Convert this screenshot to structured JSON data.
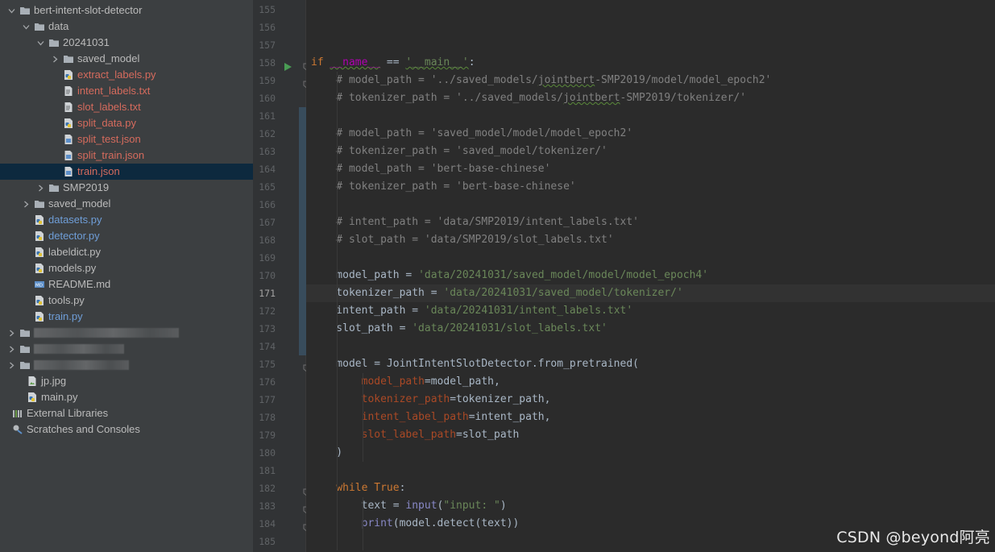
{
  "project_tree": {
    "items": [
      {
        "label": "bert-intent-slot-detector",
        "depth": 0,
        "type": "folder",
        "expanded": true,
        "color": "plain"
      },
      {
        "label": "data",
        "depth": 1,
        "type": "folder",
        "expanded": true,
        "color": "plain"
      },
      {
        "label": "20241031",
        "depth": 2,
        "type": "folder",
        "expanded": true,
        "color": "plain"
      },
      {
        "label": "saved_model",
        "depth": 3,
        "type": "folder",
        "expanded": false,
        "color": "plain"
      },
      {
        "label": "extract_labels.py",
        "depth": 3,
        "type": "python",
        "color": "red"
      },
      {
        "label": "intent_labels.txt",
        "depth": 3,
        "type": "text",
        "color": "red"
      },
      {
        "label": "slot_labels.txt",
        "depth": 3,
        "type": "text",
        "color": "red"
      },
      {
        "label": "split_data.py",
        "depth": 3,
        "type": "python",
        "color": "red"
      },
      {
        "label": "split_test.json",
        "depth": 3,
        "type": "json",
        "color": "red"
      },
      {
        "label": "split_train.json",
        "depth": 3,
        "type": "json",
        "color": "red"
      },
      {
        "label": "train.json",
        "depth": 3,
        "type": "json",
        "color": "red",
        "selected": true
      },
      {
        "label": "SMP2019",
        "depth": 2,
        "type": "folder",
        "expanded": false,
        "color": "plain"
      },
      {
        "label": "saved_model",
        "depth": 1,
        "type": "folder",
        "expanded": false,
        "color": "plain"
      },
      {
        "label": "datasets.py",
        "depth": 1,
        "type": "python",
        "color": "blue"
      },
      {
        "label": "detector.py",
        "depth": 1,
        "type": "python",
        "color": "blue"
      },
      {
        "label": "labeldict.py",
        "depth": 1,
        "type": "python",
        "color": "plain"
      },
      {
        "label": "models.py",
        "depth": 1,
        "type": "python",
        "color": "plain"
      },
      {
        "label": "README.md",
        "depth": 1,
        "type": "markdown",
        "color": "plain"
      },
      {
        "label": "tools.py",
        "depth": 1,
        "type": "python",
        "color": "plain"
      },
      {
        "label": "train.py",
        "depth": 1,
        "type": "python",
        "color": "blue"
      },
      {
        "label": "",
        "depth": 0,
        "type": "blurred",
        "blur_width": 180
      },
      {
        "label": "",
        "depth": 0,
        "type": "blurred",
        "blur_width": 112
      },
      {
        "label": "",
        "depth": 0,
        "type": "blurred",
        "blur_width": 118
      },
      {
        "label": "jp.jpg",
        "depth": 0.5,
        "type": "image",
        "color": "plain"
      },
      {
        "label": "main.py",
        "depth": 0.5,
        "type": "python",
        "color": "plain"
      },
      {
        "label": "External Libraries",
        "depth": -0.5,
        "type": "libraries",
        "color": "plain"
      },
      {
        "label": "Scratches and Consoles",
        "depth": -0.5,
        "type": "scratches",
        "color": "plain"
      }
    ]
  },
  "editor": {
    "current_line": 171,
    "lines": [
      {
        "n": 155,
        "tokens": []
      },
      {
        "n": 156,
        "tokens": []
      },
      {
        "n": 157,
        "tokens": []
      },
      {
        "n": 158,
        "run": true,
        "fold": true,
        "tokens": [
          {
            "t": "if ",
            "c": "k"
          },
          {
            "t": "__name__",
            "c": "d squig"
          },
          {
            "t": " == ",
            "c": ""
          },
          {
            "t": "'__main__'",
            "c": "s squig"
          },
          {
            "t": ":",
            "c": ""
          }
        ]
      },
      {
        "n": 159,
        "fold": true,
        "tokens": [
          {
            "t": "    # model_path = '../saved_models/",
            "c": "c"
          },
          {
            "t": "jointbert",
            "c": "c squig"
          },
          {
            "t": "-SMP2019/model/model_epoch2'",
            "c": "c"
          }
        ]
      },
      {
        "n": 160,
        "tokens": [
          {
            "t": "    # tokenizer_path = '../saved_models/",
            "c": "c"
          },
          {
            "t": "jointbert",
            "c": "c squig"
          },
          {
            "t": "-SMP2019/tokenizer/'",
            "c": "c"
          }
        ]
      },
      {
        "n": 161,
        "tokens": []
      },
      {
        "n": 162,
        "tokens": [
          {
            "t": "    # model_path = 'saved_model/model/model_epoch2'",
            "c": "c"
          }
        ]
      },
      {
        "n": 163,
        "tokens": [
          {
            "t": "    # tokenizer_path = 'saved_model/tokenizer/'",
            "c": "c"
          }
        ]
      },
      {
        "n": 164,
        "tokens": [
          {
            "t": "    # model_path = 'bert-base-chinese'",
            "c": "c"
          }
        ]
      },
      {
        "n": 165,
        "tokens": [
          {
            "t": "    # tokenizer_path = 'bert-base-chinese'",
            "c": "c"
          }
        ]
      },
      {
        "n": 166,
        "tokens": []
      },
      {
        "n": 167,
        "tokens": [
          {
            "t": "    # intent_path = 'data/SMP2019/intent_labels.txt'",
            "c": "c"
          }
        ]
      },
      {
        "n": 168,
        "fold": true,
        "tokens": [
          {
            "t": "    # slot_path = 'data/SMP2019/slot_labels.txt'",
            "c": "c"
          }
        ]
      },
      {
        "n": 169,
        "tokens": []
      },
      {
        "n": 170,
        "tokens": [
          {
            "t": "    model_path = ",
            "c": ""
          },
          {
            "t": "'data/20241031/saved_model/model/model_epoch4'",
            "c": "s"
          }
        ]
      },
      {
        "n": 171,
        "tokens": [
          {
            "t": "    tokenizer_path = ",
            "c": ""
          },
          {
            "t": "'data/20241031/saved_model/tokenizer/'",
            "c": "s"
          }
        ]
      },
      {
        "n": 172,
        "tokens": [
          {
            "t": "    intent_path = ",
            "c": ""
          },
          {
            "t": "'data/20241031/intent_labels.txt'",
            "c": "s"
          }
        ]
      },
      {
        "n": 173,
        "tokens": [
          {
            "t": "    slot_path = ",
            "c": ""
          },
          {
            "t": "'data/20241031/slot_labels.txt'",
            "c": "s"
          }
        ]
      },
      {
        "n": 174,
        "tokens": []
      },
      {
        "n": 175,
        "fold": true,
        "tokens": [
          {
            "t": "    model = JointIntentSlotDetector.from_pretrained(",
            "c": ""
          }
        ]
      },
      {
        "n": 176,
        "tokens": [
          {
            "t": "        ",
            "c": ""
          },
          {
            "t": "model_path",
            "c": "p"
          },
          {
            "t": "=model_path,",
            "c": ""
          }
        ]
      },
      {
        "n": 177,
        "tokens": [
          {
            "t": "        ",
            "c": ""
          },
          {
            "t": "tokenizer_path",
            "c": "p"
          },
          {
            "t": "=tokenizer_path,",
            "c": ""
          }
        ]
      },
      {
        "n": 178,
        "tokens": [
          {
            "t": "        ",
            "c": ""
          },
          {
            "t": "intent_label_path",
            "c": "p"
          },
          {
            "t": "=intent_path,",
            "c": ""
          }
        ]
      },
      {
        "n": 179,
        "tokens": [
          {
            "t": "        ",
            "c": ""
          },
          {
            "t": "slot_label_path",
            "c": "p"
          },
          {
            "t": "=slot_path",
            "c": ""
          }
        ]
      },
      {
        "n": 180,
        "tokens": [
          {
            "t": "    )",
            "c": ""
          }
        ]
      },
      {
        "n": 181,
        "tokens": []
      },
      {
        "n": 182,
        "fold": true,
        "tokens": [
          {
            "t": "    ",
            "c": ""
          },
          {
            "t": "while ",
            "c": "k"
          },
          {
            "t": "True",
            "c": "k"
          },
          {
            "t": ":",
            "c": ""
          }
        ]
      },
      {
        "n": 183,
        "fold": true,
        "tokens": [
          {
            "t": "        text = ",
            "c": ""
          },
          {
            "t": "input",
            "c": "b"
          },
          {
            "t": "(",
            "c": ""
          },
          {
            "t": "\"input: \"",
            "c": "s"
          },
          {
            "t": ")",
            "c": ""
          }
        ]
      },
      {
        "n": 184,
        "fold": true,
        "tokens": [
          {
            "t": "        ",
            "c": ""
          },
          {
            "t": "print",
            "c": "b"
          },
          {
            "t": "(model.detect(text))",
            "c": ""
          }
        ]
      },
      {
        "n": 185,
        "tokens": []
      }
    ]
  },
  "watermark": "CSDN @beyond阿亮",
  "colors": {
    "keyword": "#cc7832",
    "string": "#6a8759",
    "comment": "#808080",
    "param": "#aa4926",
    "builtin": "#8888c6",
    "dunder": "#b200b2",
    "vcs_red": "#d66b5d",
    "vcs_blue": "#6f9ed8"
  }
}
